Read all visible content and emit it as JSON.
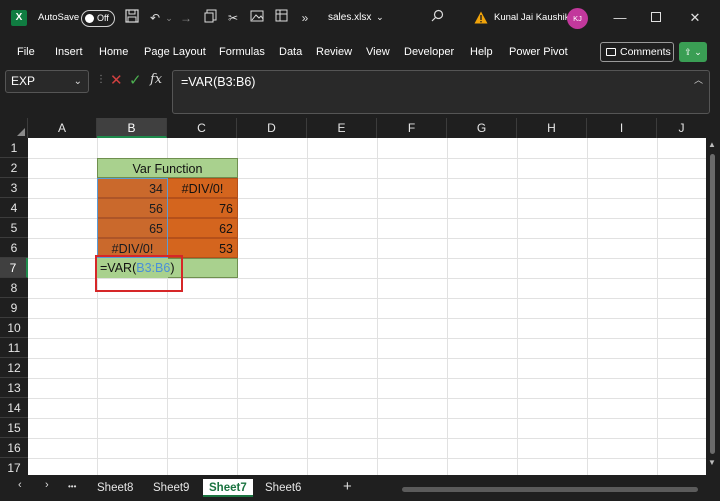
{
  "titlebar": {
    "autosave_label": "AutoSave",
    "autosave_state": "Off",
    "filename": "sales.xlsx",
    "filename_chevron": "⌄",
    "user_name": "Kunal Jai Kaushik",
    "user_initials": "KJ",
    "more_glyph": "»"
  },
  "ribbon": {
    "menu": [
      "File",
      "Insert",
      "Home",
      "Page Layout",
      "Formulas",
      "Data",
      "Review",
      "View",
      "Developer",
      "Help",
      "Power Pivot"
    ],
    "comments_label": "Comments"
  },
  "formula_bar": {
    "name_box": "EXP",
    "formula": "=VAR(B3:B6)",
    "fx_label": "fx"
  },
  "grid": {
    "columns": [
      "A",
      "B",
      "C",
      "D",
      "E",
      "F",
      "G",
      "H",
      "I",
      "J"
    ],
    "rows": [
      "1",
      "2",
      "3",
      "4",
      "5",
      "6",
      "7",
      "8",
      "9",
      "10",
      "11",
      "12",
      "13",
      "14",
      "15",
      "16",
      "17"
    ],
    "selected_column": "B",
    "selected_row": "7",
    "header_title": "Var Function",
    "cells": {
      "B3": "34",
      "C3": "#DIV/0!",
      "B4": "56",
      "C4": "76",
      "B5": "65",
      "C5": "62",
      "B6": "#DIV/0!",
      "C6": "53"
    },
    "editing_cell": {
      "prefix": "=VAR(",
      "ref": "B3:B6",
      "suffix": ")"
    },
    "colors": {
      "orange_fill": "#d4651e",
      "green_fill": "#a9d18e",
      "highlight_box": "#d62728"
    }
  },
  "sheets": {
    "tabs": [
      "Sheet8",
      "Sheet9",
      "Sheet7",
      "Sheet6"
    ],
    "active": "Sheet7",
    "ellipsis": "•••"
  }
}
